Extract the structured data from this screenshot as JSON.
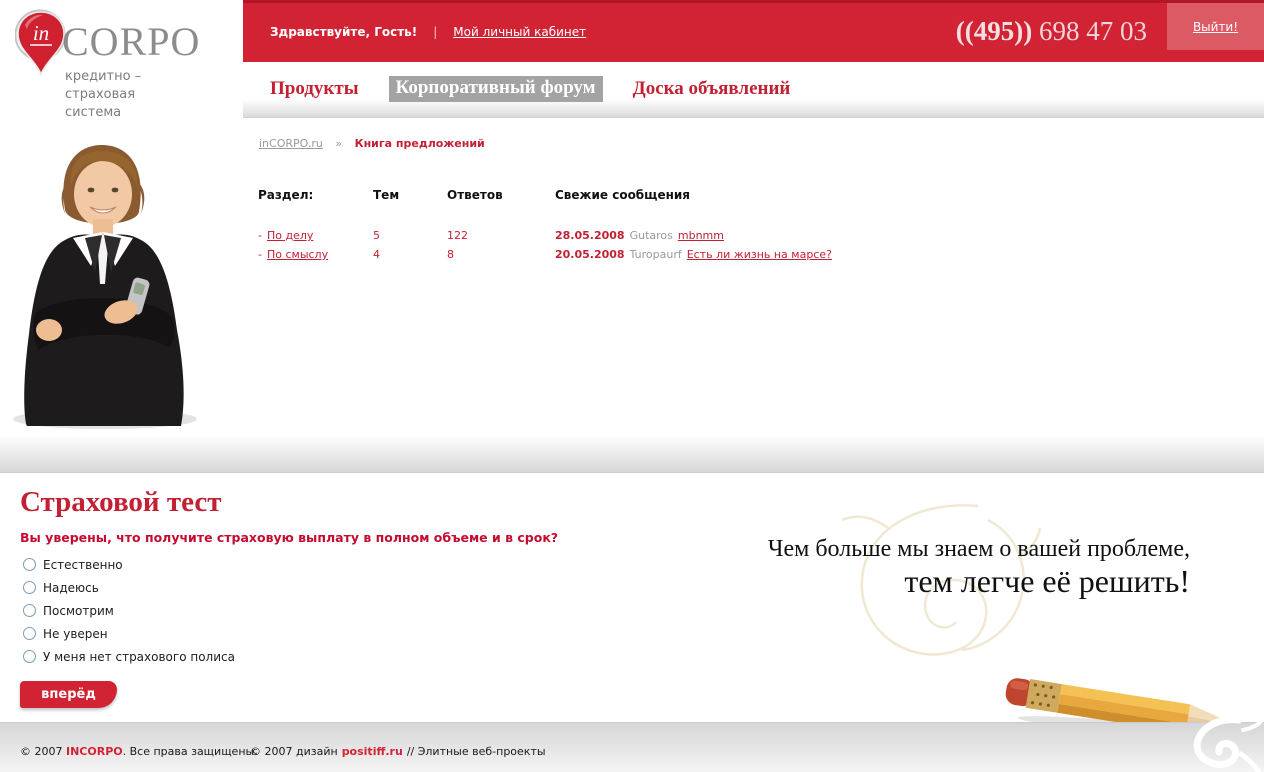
{
  "logo": {
    "pin_text": "in",
    "name": "CORPO",
    "tagline1": "кредитно –",
    "tagline2": "страховая",
    "tagline3": "система"
  },
  "header": {
    "greeting": "Здравствуйте, Гость!",
    "divider": "|",
    "cabinet_link": "Мой личный кабинет",
    "phone_code": "((495))",
    "phone_number": "698 47 03",
    "logout": "Выйти!"
  },
  "nav": {
    "tabs": [
      {
        "label": "Продукты",
        "active": false
      },
      {
        "label": "Корпоративный форум",
        "active": true
      },
      {
        "label": "Доска объявлений",
        "active": false
      }
    ]
  },
  "breadcrumb": {
    "home": "inCORPO.ru",
    "separator": "»",
    "current": "Книга предложений"
  },
  "forum": {
    "columns": [
      "Раздел:",
      "Тем",
      "Ответов",
      "Свежие сообщения"
    ],
    "bullet": "-",
    "rows": [
      {
        "section": "По делу",
        "topics": "5",
        "replies": "122",
        "date": "28.05.2008",
        "author": "Gutaros",
        "topic": "mbnmm"
      },
      {
        "section": "По смыслу",
        "topics": "4",
        "replies": "8",
        "date": "20.05.2008",
        "author": "Turopaurf",
        "topic": "Есть ли жизнь на марсе?"
      }
    ]
  },
  "test": {
    "title": "Страховой тест",
    "question": "Вы уверены, что получите страховую выплату в полном объеме и в срок?",
    "options": [
      {
        "label": "Естественно"
      },
      {
        "label": "Надеюсь"
      },
      {
        "label": "Посмотрим"
      },
      {
        "label": "Не уверен"
      },
      {
        "label": "У меня нет страхового полиса"
      }
    ],
    "submit": "вперёд"
  },
  "slogan": {
    "line1": "Чем больше мы знаем о вашей проблеме,",
    "line2": "тем легче её решить!"
  },
  "footer": {
    "copyright": "© 2007 ",
    "brand": "INCORPO",
    "rights": ". Все права защищены.",
    "design_copyright": "© 2007 дизайн",
    "design_link": "positiff.ru",
    "design_suffix": "// Элитные веб-проекты"
  },
  "colors": {
    "header_red": "#d22334",
    "logout_red": "#db5a64",
    "link_red": "#c22033",
    "active_tab_gray": "#a3a3a3",
    "muted_gray": "#999999"
  }
}
